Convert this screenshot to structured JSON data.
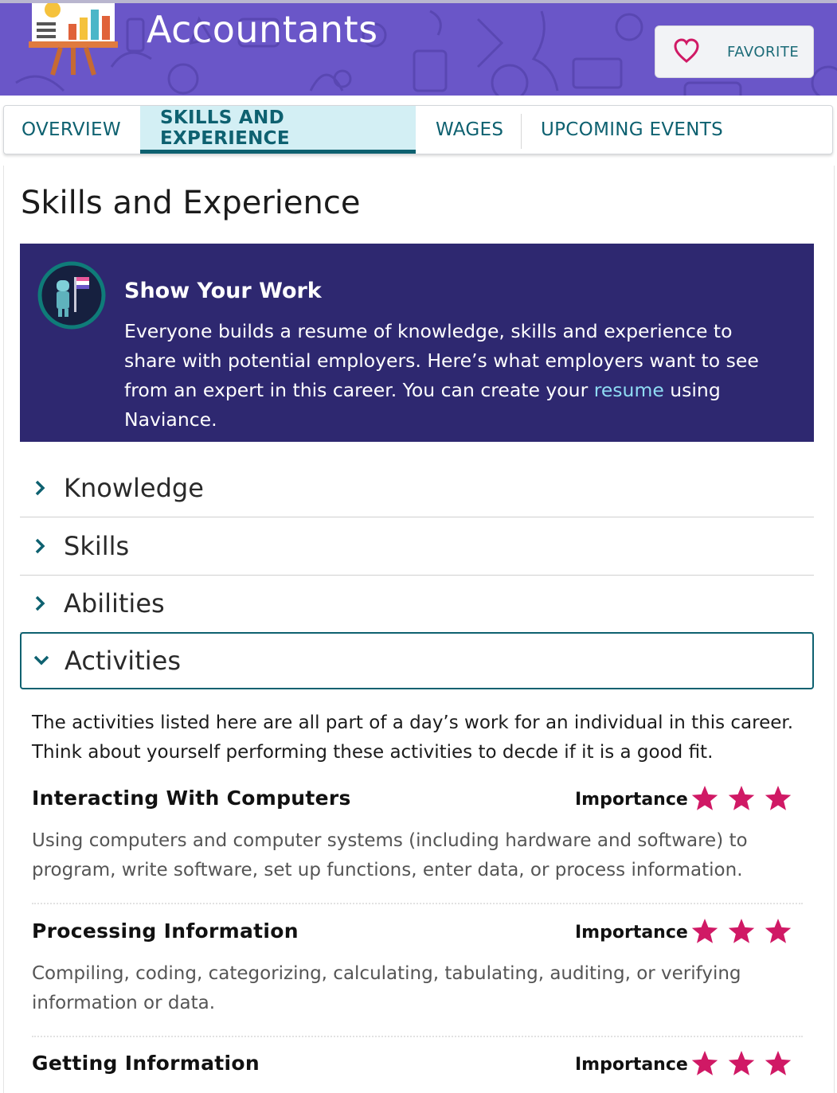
{
  "header": {
    "title": "Accountants",
    "favorite_label": "FAVORITE",
    "banner_color": "#6a56c8"
  },
  "tabs": [
    {
      "label": "OVERVIEW",
      "active": false
    },
    {
      "label": "SKILLS AND EXPERIENCE",
      "active": true
    },
    {
      "label": "WAGES",
      "active": false
    },
    {
      "label": "UPCOMING EVENTS",
      "active": false
    }
  ],
  "page_title": "Skills and Experience",
  "callout": {
    "title": "Show Your Work",
    "body_before": "Everyone builds a resume of knowledge, skills and experience to share with potential employers. Here’s what employers want to see from an expert in this career. You can create your ",
    "link_text": "resume",
    "body_after": " using Naviance.",
    "bg_color": "#2e2870"
  },
  "accordion": [
    {
      "label": "Knowledge",
      "open": false
    },
    {
      "label": "Skills",
      "open": false
    },
    {
      "label": "Abilities",
      "open": false
    },
    {
      "label": "Activities",
      "open": true
    }
  ],
  "activities_intro": "The activities listed here are all part of a day’s work for an individual in this career. Think about yourself performing these activities to decde if it is a good fit.",
  "importance_label": "Importance",
  "star_color": "#d01965",
  "activities": [
    {
      "title": "Interacting With Computers",
      "importance": 3,
      "description": "Using computers and computer systems (including hardware and software) to program, write software, set up functions, enter data, or process information."
    },
    {
      "title": "Processing Information",
      "importance": 3,
      "description": "Compiling, coding, categorizing, calculating, tabulating, auditing, or verifying information or data."
    },
    {
      "title": "Getting Information",
      "importance": 3,
      "description": ""
    }
  ]
}
